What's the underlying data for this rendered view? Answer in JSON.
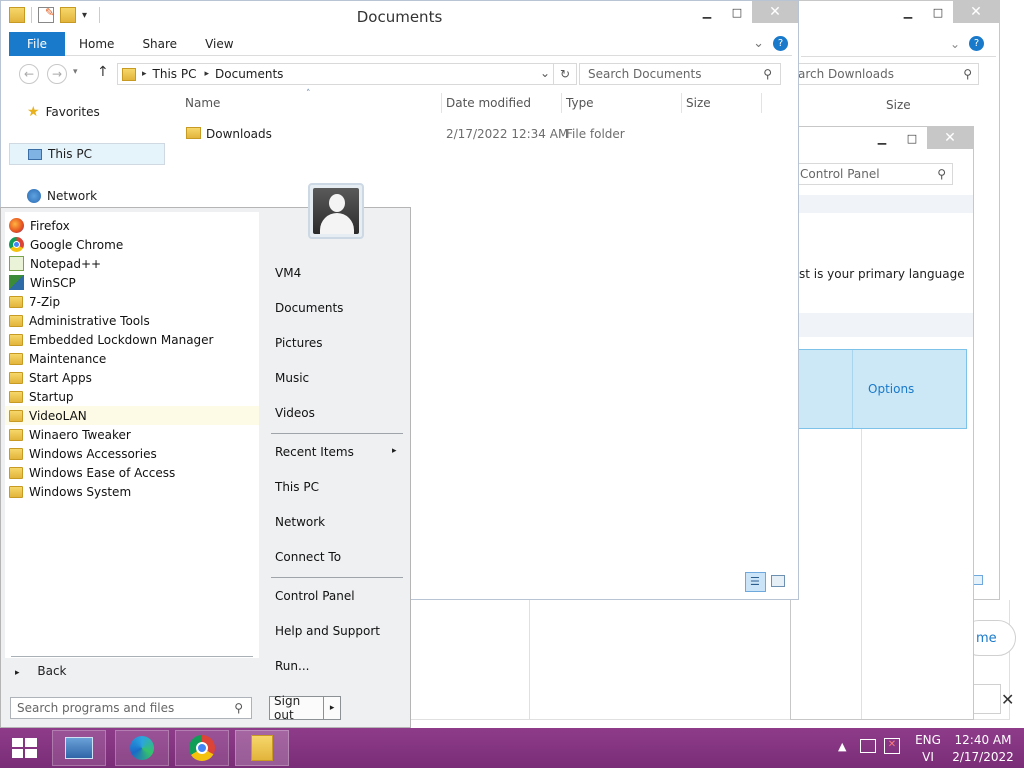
{
  "explorer": {
    "title": "Documents",
    "tabs": [
      "File",
      "Home",
      "Share",
      "View"
    ],
    "address": {
      "root": "This PC",
      "current": "Documents"
    },
    "search_placeholder": "Search Documents",
    "nav": {
      "favorites": "Favorites",
      "thispc": "This PC",
      "network": "Network"
    },
    "columns": {
      "name": "Name",
      "date": "Date modified",
      "type": "Type",
      "size": "Size"
    },
    "file": {
      "name": "Downloads",
      "date": "2/17/2022 12:34 AM",
      "type": "File folder"
    }
  },
  "bg_window_downloads": {
    "search_placeholder": "arch Downloads",
    "size_header": "Size"
  },
  "bg_window_control": {
    "search_placeholder": "Control Panel",
    "text_fragment": "st is your primary language",
    "options_label": "Options"
  },
  "bg_window_far": {
    "link_fragment": "me"
  },
  "startmenu": {
    "programs": [
      "Firefox",
      "Google Chrome",
      "Notepad++",
      "WinSCP",
      "7-Zip",
      "Administrative Tools",
      "Embedded Lockdown Manager",
      "Maintenance",
      "Start Apps",
      "Startup",
      "VideoLAN",
      "Winaero Tweaker",
      "Windows Accessories",
      "Windows Ease of Access",
      "Windows System"
    ],
    "right": {
      "user": "VM4",
      "documents": "Documents",
      "pictures": "Pictures",
      "music": "Music",
      "videos": "Videos",
      "recent": "Recent Items",
      "thispc": "This PC",
      "network": "Network",
      "connect": "Connect To",
      "control": "Control Panel",
      "help": "Help and Support",
      "run": "Run..."
    },
    "back": "Back",
    "search_placeholder": "Search programs and files",
    "signout": "Sign out"
  },
  "taskbar": {
    "lang_top": "ENG",
    "lang_bottom": "VI",
    "time": "12:40 AM",
    "date": "2/17/2022"
  },
  "colors": {
    "taskbar": "#7e3179",
    "file_tab": "#1979ca",
    "selection": "#cce8f6"
  }
}
